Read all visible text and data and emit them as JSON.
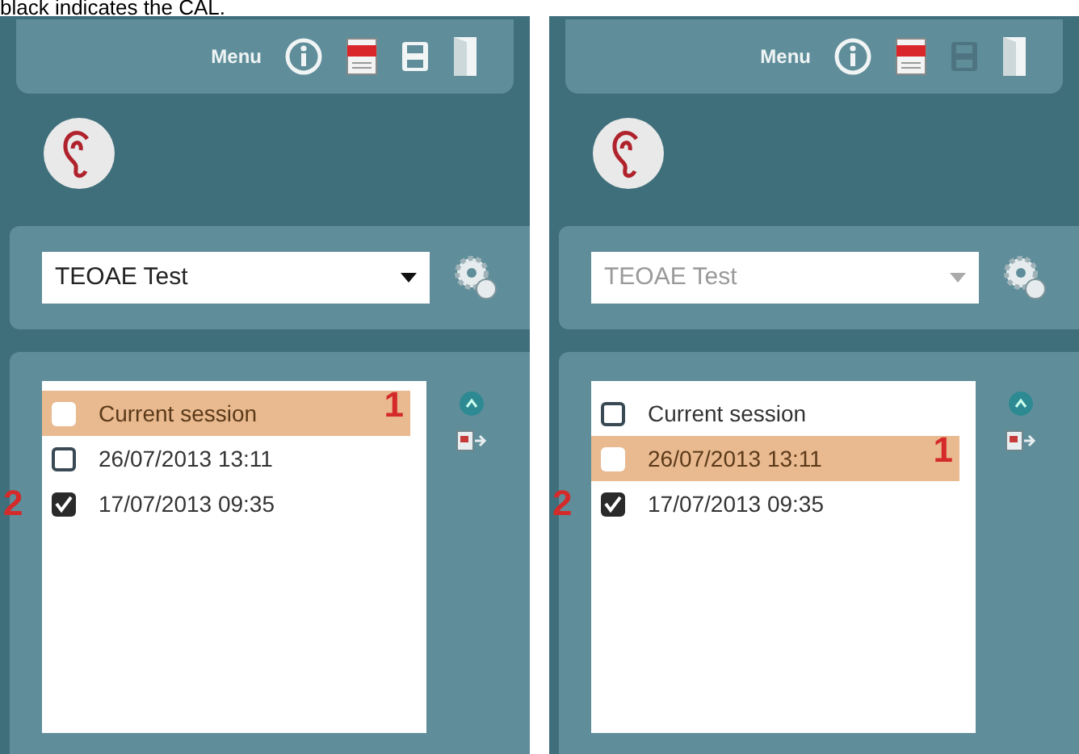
{
  "caption": "black indicates the CAL.",
  "panels": [
    {
      "menu_label": "Menu",
      "save_enabled": true,
      "test_select": {
        "value": "TEOAE Test",
        "disabled": false
      },
      "sessions": [
        {
          "label": "Current session",
          "checked": false,
          "selected": true,
          "annotation": "1"
        },
        {
          "label": "26/07/2013 13:11",
          "checked": false,
          "selected": false
        },
        {
          "label": "17/07/2013 09:35",
          "checked": true,
          "selected": false,
          "annotation": "2"
        }
      ]
    },
    {
      "menu_label": "Menu",
      "save_enabled": false,
      "test_select": {
        "value": "TEOAE Test",
        "disabled": true
      },
      "sessions": [
        {
          "label": "Current session",
          "checked": false,
          "selected": false
        },
        {
          "label": "26/07/2013 13:11",
          "checked": false,
          "selected": true,
          "annotation": "1"
        },
        {
          "label": "17/07/2013 09:35",
          "checked": true,
          "selected": false,
          "annotation": "2"
        }
      ]
    }
  ]
}
